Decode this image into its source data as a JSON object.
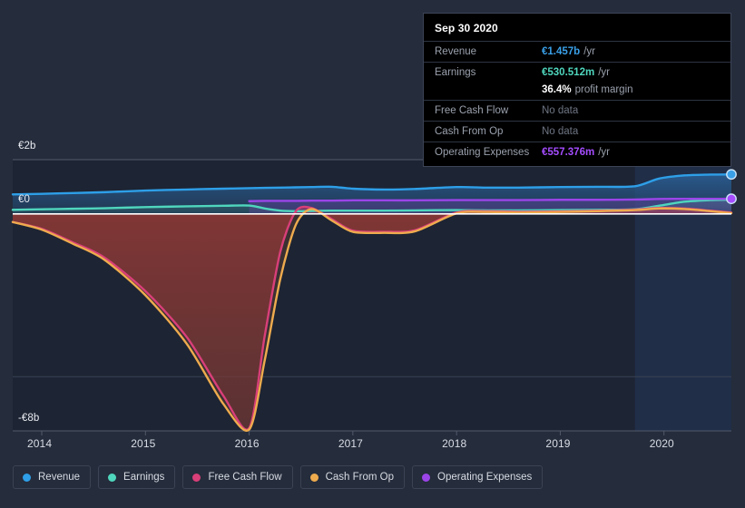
{
  "tooltip": {
    "title": "Sep 30 2020",
    "rows": [
      {
        "label": "Revenue",
        "value": "€1.457b",
        "unit": "/yr",
        "color": "#3aa0e8",
        "nodata": false
      },
      {
        "label": "Earnings",
        "value": "€530.512m",
        "unit": "/yr",
        "color": "#4fd6bd",
        "nodata": false
      },
      {
        "label": "",
        "value": "36.4%",
        "unit": "profit margin",
        "color": "#ffffff",
        "nodata": false,
        "sub": true
      },
      {
        "label": "Free Cash Flow",
        "value": "No data",
        "unit": "",
        "color": "#6e7583",
        "nodata": true
      },
      {
        "label": "Cash From Op",
        "value": "No data",
        "unit": "",
        "color": "#6e7583",
        "nodata": true
      },
      {
        "label": "Operating Expenses",
        "value": "€557.376m",
        "unit": "/yr",
        "color": "#a54dff",
        "nodata": false
      }
    ]
  },
  "legend": {
    "items": [
      {
        "label": "Revenue",
        "color": "#2e9fe8"
      },
      {
        "label": "Earnings",
        "color": "#4fd6bd"
      },
      {
        "label": "Free Cash Flow",
        "color": "#d93f79"
      },
      {
        "label": "Cash From Op",
        "color": "#eeab4e"
      },
      {
        "label": "Operating Expenses",
        "color": "#9b45e8"
      }
    ]
  },
  "chart_data": {
    "type": "line",
    "title": "",
    "xlabel": "",
    "ylabel": "",
    "ylim": [
      -8,
      2
    ],
    "xlim": [
      2013.72,
      2020.65
    ],
    "grid": true,
    "legend_position": "bottom",
    "currency": "EUR",
    "y_ticks": [
      {
        "value": 2,
        "label": "€2b"
      },
      {
        "value": 0,
        "label": "€0"
      },
      {
        "value": -8,
        "label": "-€8b"
      }
    ],
    "x_ticks": [
      {
        "value": 2014,
        "label": "2014"
      },
      {
        "value": 2015,
        "label": "2015"
      },
      {
        "value": 2016,
        "label": "2016"
      },
      {
        "value": 2017,
        "label": "2017"
      },
      {
        "value": 2018,
        "label": "2018"
      },
      {
        "value": 2019,
        "label": "2019"
      },
      {
        "value": 2020,
        "label": "2020"
      }
    ],
    "forecast_start": 2019.72,
    "x": [
      2013.72,
      2014.0,
      2014.3,
      2014.6,
      2015.0,
      2015.4,
      2015.75,
      2016.0,
      2016.15,
      2016.3,
      2016.45,
      2016.6,
      2016.8,
      2017.0,
      2017.3,
      2017.6,
      2018.0,
      2018.3,
      2018.6,
      2019.0,
      2019.35,
      2019.72,
      2019.95,
      2020.2,
      2020.45,
      2020.65
    ],
    "series": [
      {
        "name": "Revenue",
        "color": "#2e9fe8",
        "fill": "rgba(38,95,150,0.55)",
        "values": [
          0.72,
          0.74,
          0.77,
          0.8,
          0.86,
          0.9,
          0.93,
          0.95,
          0.96,
          0.97,
          0.98,
          0.99,
          1.0,
          0.93,
          0.9,
          0.92,
          0.99,
          0.97,
          0.97,
          0.99,
          1.0,
          1.02,
          1.3,
          1.42,
          1.45,
          1.457
        ]
      },
      {
        "name": "Earnings",
        "color": "#4fd6bd",
        "fill": "rgba(53,130,125,0.35)",
        "values": [
          0.15,
          0.17,
          0.19,
          0.21,
          0.25,
          0.28,
          0.3,
          0.31,
          0.2,
          0.12,
          0.1,
          0.11,
          0.12,
          0.12,
          0.12,
          0.13,
          0.14,
          0.13,
          0.13,
          0.14,
          0.15,
          0.17,
          0.3,
          0.45,
          0.51,
          0.5305
        ]
      },
      {
        "name": "Free Cash Flow",
        "color": "#d93f79",
        "fill": "rgba(150,45,55,0.55)",
        "values": [
          -0.3,
          -0.55,
          -1.05,
          -1.6,
          -2.85,
          -4.55,
          -6.7,
          -7.9,
          -4.5,
          -1.4,
          0.1,
          0.22,
          -0.2,
          -0.62,
          -0.66,
          -0.6,
          0.05,
          0.1,
          0.08,
          0.09,
          0.12,
          0.16,
          0.22,
          0.2,
          0.12,
          0.05
        ]
      },
      {
        "name": "Cash From Op",
        "color": "#eeab4e",
        "fill": "rgba(150,70,45,0.0)",
        "values": [
          -0.3,
          -0.58,
          -1.1,
          -1.68,
          -3.0,
          -4.8,
          -7.0,
          -7.95,
          -5.4,
          -2.4,
          -0.4,
          0.18,
          -0.25,
          -0.66,
          -0.7,
          -0.64,
          0.02,
          0.07,
          0.05,
          0.07,
          0.1,
          0.14,
          0.2,
          0.18,
          0.1,
          0.03
        ]
      },
      {
        "name": "Operating Expenses",
        "color": "#9b45e8",
        "fill": "rgba(120,60,180,0.0)",
        "values": [
          null,
          null,
          null,
          null,
          null,
          null,
          null,
          0.47,
          0.48,
          0.48,
          0.48,
          0.49,
          0.49,
          0.5,
          0.5,
          0.5,
          0.51,
          0.51,
          0.51,
          0.52,
          0.52,
          0.53,
          0.55,
          0.556,
          0.557,
          0.5574
        ]
      }
    ],
    "endpoints": [
      {
        "series": "Revenue",
        "x": 2020.65,
        "y": 1.457,
        "color": "#3aa0e8"
      },
      {
        "series": "Operating Expenses",
        "x": 2020.65,
        "y": 0.5574,
        "color": "#a54dff"
      }
    ]
  }
}
